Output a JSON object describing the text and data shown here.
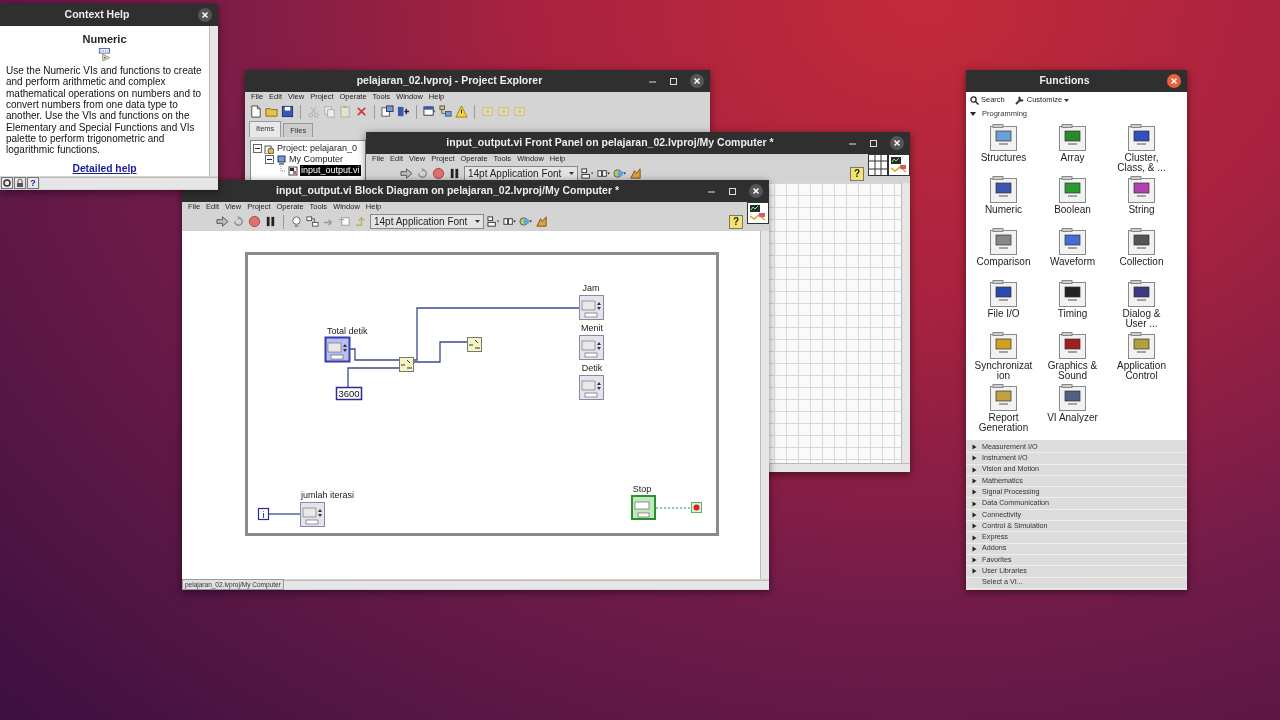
{
  "context_help": {
    "title": "Context Help",
    "heading": "Numeric",
    "description": "Use the Numeric VIs and functions to create and perform arithmetic and complex mathematical operations on numbers and to convert numbers from one data type to another. Use the VIs and functions on the Elementary and Special Functions and VIs palette to perform trigonometric and logarithmic functions.",
    "link": "Detailed help",
    "help_button": "?"
  },
  "project_explorer": {
    "title": "pelajaran_02.lvproj - Project Explorer",
    "menu": [
      "File",
      "Edit",
      "View",
      "Project",
      "Operate",
      "Tools",
      "Window",
      "Help"
    ],
    "tabs": [
      {
        "label": "Items",
        "selected": true
      },
      {
        "label": "Files",
        "selected": false
      }
    ],
    "tree": [
      {
        "label": "Project: pelajaran_0",
        "expanded": true,
        "selected": false,
        "children": [
          {
            "label": "My Computer",
            "expanded": true,
            "selected": false,
            "children": [
              {
                "label": "input_output.vi",
                "selected": true
              }
            ]
          }
        ]
      }
    ]
  },
  "front_panel": {
    "title": "input_output.vi Front Panel on pelajaran_02.lvproj/My Computer *",
    "menu": [
      "File",
      "Edit",
      "View",
      "Project",
      "Operate",
      "Tools",
      "Window",
      "Help"
    ],
    "font_menu": "14pt Application Font",
    "help_button": "?"
  },
  "block_diagram": {
    "title": "input_output.vi Block Diagram on pelajaran_02.lvproj/My Computer *",
    "menu": [
      "File",
      "Edit",
      "View",
      "Project",
      "Operate",
      "Tools",
      "Window",
      "Help"
    ],
    "font_menu": "14pt Application Font",
    "help_button": "?",
    "nodes": [
      {
        "kind": "control",
        "label": "Total detik"
      },
      {
        "kind": "constant",
        "value": "3600"
      },
      {
        "kind": "function"
      },
      {
        "kind": "function"
      },
      {
        "kind": "indicator",
        "label": "Jam"
      },
      {
        "kind": "indicator",
        "label": "Menit"
      },
      {
        "kind": "indicator",
        "label": "Detik"
      },
      {
        "kind": "iteration",
        "value": "i"
      },
      {
        "kind": "indicator",
        "label": "jumlah iterasi"
      },
      {
        "kind": "boolean",
        "label": "Stop"
      },
      {
        "kind": "stop"
      }
    ],
    "status_bar": "pelajaran_02.lvproj/My Computer"
  },
  "functions_palette": {
    "title": "Functions",
    "search": "Search",
    "customize": "Customize",
    "categories": [
      {
        "kind": "category",
        "label": "Programming",
        "expanded": true,
        "items": [
          "Structures",
          "Array",
          "Cluster, Class, & ...",
          "Numeric",
          "Boolean",
          "String",
          "Comparison",
          "Waveform",
          "Collection",
          "File I/O",
          "Timing",
          "Dialog & User ...",
          "Synchronization",
          "Graphics & Sound",
          "Application Control",
          "Report Generation",
          "VI Analyzer"
        ]
      },
      {
        "kind": "category",
        "label": "Measurement I/O",
        "expanded": false
      },
      {
        "kind": "category",
        "label": "Instrument I/O",
        "expanded": false
      },
      {
        "kind": "category",
        "label": "Vision and Motion",
        "expanded": false
      },
      {
        "kind": "category",
        "label": "Mathematics",
        "expanded": false
      },
      {
        "kind": "category",
        "label": "Signal Processing",
        "expanded": false
      },
      {
        "kind": "category",
        "label": "Data Communication",
        "expanded": false
      },
      {
        "kind": "category",
        "label": "Connectivity",
        "expanded": false
      },
      {
        "kind": "category",
        "label": "Control & Simulation",
        "expanded": false
      },
      {
        "kind": "category",
        "label": "Express",
        "expanded": false
      },
      {
        "kind": "category",
        "label": "Addons",
        "expanded": false
      },
      {
        "kind": "category",
        "label": "Favorites",
        "expanded": false
      },
      {
        "kind": "category",
        "label": "User Libraries",
        "expanded": false
      },
      {
        "kind": "action",
        "label": "Select a VI..."
      }
    ]
  }
}
